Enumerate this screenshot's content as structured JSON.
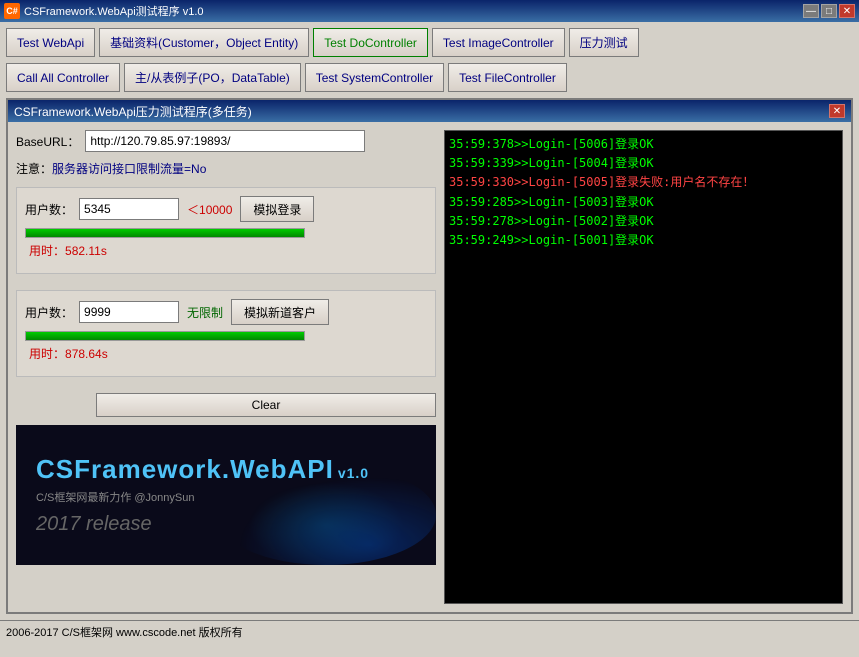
{
  "titlebar": {
    "icon": "C#",
    "title": "CSFramework.WebApi测试程序 v1.0",
    "min_label": "—",
    "max_label": "□",
    "close_label": "✕"
  },
  "toolbar": {
    "row1": [
      {
        "id": "test-webapi",
        "label": "Test WebApi"
      },
      {
        "id": "basic-data",
        "label": "基础资料(Customer，Object Entity)"
      },
      {
        "id": "test-do",
        "label": "Test DoController",
        "active": true
      },
      {
        "id": "test-image",
        "label": "Test ImageController"
      },
      {
        "id": "stress-test",
        "label": "压力测试"
      }
    ],
    "row2": [
      {
        "id": "call-all",
        "label": "Call All Controller"
      },
      {
        "id": "master-detail",
        "label": "主/从表例子(PO，DataTable)"
      },
      {
        "id": "test-system",
        "label": "Test SystemController"
      },
      {
        "id": "test-file",
        "label": "Test FileController"
      }
    ]
  },
  "dialog": {
    "title": "CSFramework.WebApi压力测试程序(多任务)",
    "close_label": "✕",
    "base_url_label": "BaseURL：",
    "base_url_value": "http://120.79.85.97:19893/",
    "note_label": "注意：",
    "note_text": "服务器访问接口限制流量=No",
    "section1": {
      "user_count_label": "用户数：",
      "user_count_value": "5345",
      "limit_text": "＜10000",
      "simulate_btn_label": "模拟登录",
      "progress_pct": 100,
      "time_label": "用时：",
      "time_value": "582.11s"
    },
    "section2": {
      "user_count_label": "用户数：",
      "user_count_value": "9999",
      "limit_text": "无限制",
      "simulate_btn_label": "模拟新道客户",
      "progress_pct": 100,
      "time_label": "用时：",
      "time_value": "878.64s"
    },
    "clear_btn_label": "Clear"
  },
  "banner": {
    "title_part1": "CSFramework.",
    "title_part2": "WebAPI",
    "version": "v1.0",
    "subtitle": "C/S框架网最新力作 @JonnySun",
    "year": "2017 release"
  },
  "log": {
    "lines": [
      {
        "text": "35:59:378>>Login-[5006]登录OK",
        "type": "ok"
      },
      {
        "text": "35:59:339>>Login-[5004]登录OK",
        "type": "ok"
      },
      {
        "text": "35:59:330>>Login-[5005]登录失败:用户名不存在！",
        "type": "error"
      },
      {
        "text": "35:59:285>>Login-[5003]登录OK",
        "type": "ok"
      },
      {
        "text": "35:59:278>>Login-[5002]登录OK",
        "type": "ok"
      },
      {
        "text": "35:59:249>>Login-[5001]登录OK",
        "type": "ok"
      }
    ]
  },
  "statusbar": {
    "text": "2006-2017 C/S框架网 www.cscode.net 版权所有"
  }
}
